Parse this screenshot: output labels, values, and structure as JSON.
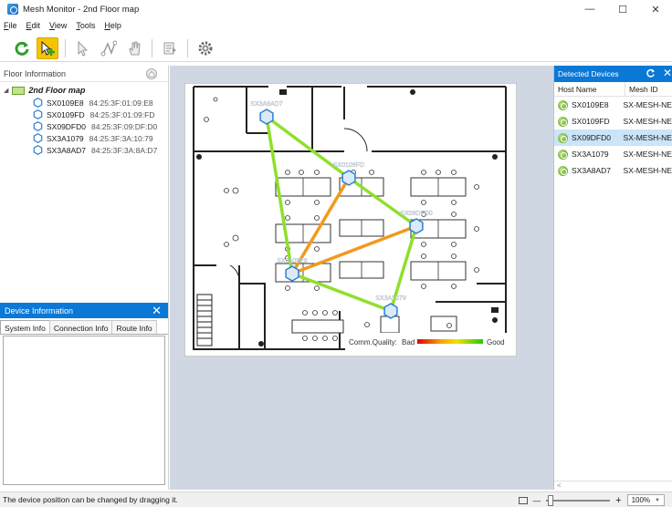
{
  "window": {
    "title": "Mesh Monitor - 2nd Floor map"
  },
  "menu": [
    {
      "u": "F",
      "rest": "ile"
    },
    {
      "u": "E",
      "rest": "dit"
    },
    {
      "u": "V",
      "rest": "iew"
    },
    {
      "u": "T",
      "rest": "ools"
    },
    {
      "u": "H",
      "rest": "elp"
    }
  ],
  "toolbar": {
    "icons": [
      "refresh-icon",
      "move-device-icon",
      "pointer-icon",
      "route-icon",
      "hand-icon",
      "device-list-icon",
      "settings-icon"
    ]
  },
  "floor_info": {
    "header": "Floor Information",
    "root": "2nd Floor map",
    "devices": [
      {
        "name": "SX0109E8",
        "mac": "84:25:3F:01:09:E8"
      },
      {
        "name": "SX0109FD",
        "mac": "84:25:3F:01:09:FD"
      },
      {
        "name": "SX09DFD0",
        "mac": "84:25:3F:09:DF:D0"
      },
      {
        "name": "SX3A1079",
        "mac": "84:25:3F:3A:10:79"
      },
      {
        "name": "SX3A8AD7",
        "mac": "84:25:3F:3A:8A:D7"
      }
    ]
  },
  "device_info": {
    "header": "Device Information",
    "tabs": [
      "System Info",
      "Connection Info",
      "Route Info"
    ]
  },
  "map": {
    "quality_label": "Comm.Quality:",
    "bad": "Bad",
    "good": "Good",
    "nodes": [
      {
        "id": "n1",
        "label": "SX3A8AD7"
      },
      {
        "id": "n2",
        "label": "SX0109FD"
      },
      {
        "id": "n3",
        "label": "SX09DFD0"
      },
      {
        "id": "n4",
        "label": "SX0109E8"
      },
      {
        "id": "n5",
        "label": "SX3A1079"
      }
    ],
    "colors": {
      "good": "#8ee02a",
      "fair": "#f29a1c",
      "node": "#2e7fd0"
    }
  },
  "detected": {
    "header": "Detected Devices",
    "col_host": "Host Name",
    "col_mesh": "Mesh ID",
    "rows": [
      {
        "host": "SX0109E8",
        "mesh": "SX-MESH-NET"
      },
      {
        "host": "SX0109FD",
        "mesh": "SX-MESH-NET"
      },
      {
        "host": "SX09DFD0",
        "mesh": "SX-MESH-NET",
        "selected": true
      },
      {
        "host": "SX3A1079",
        "mesh": "SX-MESH-NET"
      },
      {
        "host": "SX3A8AD7",
        "mesh": "SX-MESH-NET"
      }
    ]
  },
  "status": {
    "text": "The device position can be changed by dragging it.",
    "zoom": "100%"
  }
}
